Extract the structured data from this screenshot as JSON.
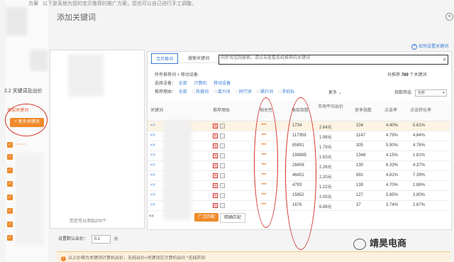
{
  "top_note": {
    "prefix": "方案",
    "text": "以下是系统为您的宝贝推荐的推广方案，您也可以自己进行手工调整。"
  },
  "dialog": {
    "title": "添加关键词",
    "close": "×"
  },
  "help_link": "如何设置关键词",
  "section_label": "2.2 关键词及出价",
  "left": {
    "red_link": "添加关键词",
    "more_button": "+ 更多关键词",
    "kw_count_note": "您还可以添加200个"
  },
  "tabs": [
    {
      "label": "宝贝推词"
    },
    {
      "label": "搜索关键词"
    }
  ],
  "search": {
    "placeholder": "同步淘宝网搜索，请点击查看系统推荐的关键词"
  },
  "breadcrumb": {
    "root": "所有推荐词",
    "sep": ">",
    "current": "移动设备"
  },
  "device_filter": {
    "label": "选择设备：",
    "options": [
      "全部",
      "计算机",
      "移动设备"
    ]
  },
  "reason_filter": {
    "label": "推荐理由：",
    "options": [
      "全部",
      "热搜词",
      "潜力词",
      "同行词",
      "飙升词",
      "手机标"
    ],
    "more": "更多"
  },
  "total": {
    "prefix": "共推荐",
    "count": "789",
    "suffix": "个关键词"
  },
  "index_filter": {
    "label": "指数筛选",
    "value": "全部"
  },
  "table": {
    "headers": [
      "关键词",
      "推荐理由",
      "相关性",
      "展现指数",
      "市场平均出价",
      "竞争指数",
      "点击率",
      "点击转化率"
    ],
    "rows": [
      {
        "kw": "<< ",
        "rel": "*****",
        "impr": "1734",
        "bid": "2.64元",
        "comp": "104",
        "ctr": "4.40%",
        "cvr": "5.61%"
      },
      {
        "kw": "<< ",
        "rel": "*****",
        "impr": "117959",
        "bid": "1.98元",
        "comp": "1147",
        "ctr": "4.79%",
        "cvr": "4.84%"
      },
      {
        "kw": "<< ",
        "rel": "*****",
        "impr": "85891",
        "bid": "1.79元",
        "comp": "305",
        "ctr": "5.90%",
        "cvr": "4.76%"
      },
      {
        "kw": "<< ",
        "rel": "*****",
        "impr": "199885",
        "bid": "1.63元",
        "comp": "1348",
        "ctr": "4.15%",
        "cvr": "1.81%"
      },
      {
        "kw": "<< ",
        "rel": "*****",
        "impr": "28406",
        "bid": "2.26元",
        "comp": "130",
        "ctr": "6.33%",
        "cvr": "4.37%"
      },
      {
        "kw": "<< ",
        "rel": "*****",
        "impr": "46451",
        "bid": "2.20元",
        "comp": "691",
        "ctr": "4.81%",
        "cvr": "7.39%"
      },
      {
        "kw": "<< ",
        "rel": "*****",
        "impr": "4793",
        "bid": "1.22元",
        "comp": "139",
        "ctr": "4.70%",
        "cvr": "1.86%"
      },
      {
        "kw": "<< ",
        "rel": "*****",
        "impr": "15852",
        "bid": "2.05元",
        "comp": "127",
        "ctr": "5.85%",
        "cvr": "3.80%"
      },
      {
        "kw": "<< ",
        "rel": "*****",
        "impr": "1676",
        "bid": "6.88元",
        "comp": "37",
        "ctr": "3.74%",
        "cvr": "2.67%"
      }
    ]
  },
  "bottom": {
    "prev": "<<",
    "btn_orange": "广泛匹配",
    "btn_plain": "精确匹配"
  },
  "bid_row": {
    "label": "设置默认出价：",
    "value": "0.1",
    "unit": "元"
  },
  "warning": "以上价格为关键词计算机出价，无线出价=关键词在计算机出价 *无线折扣",
  "watermark": "靖昊电商",
  "colors": {
    "accent": "#3b7dd8",
    "orange": "#f08a2a",
    "annotation_red": "#d4322a"
  }
}
